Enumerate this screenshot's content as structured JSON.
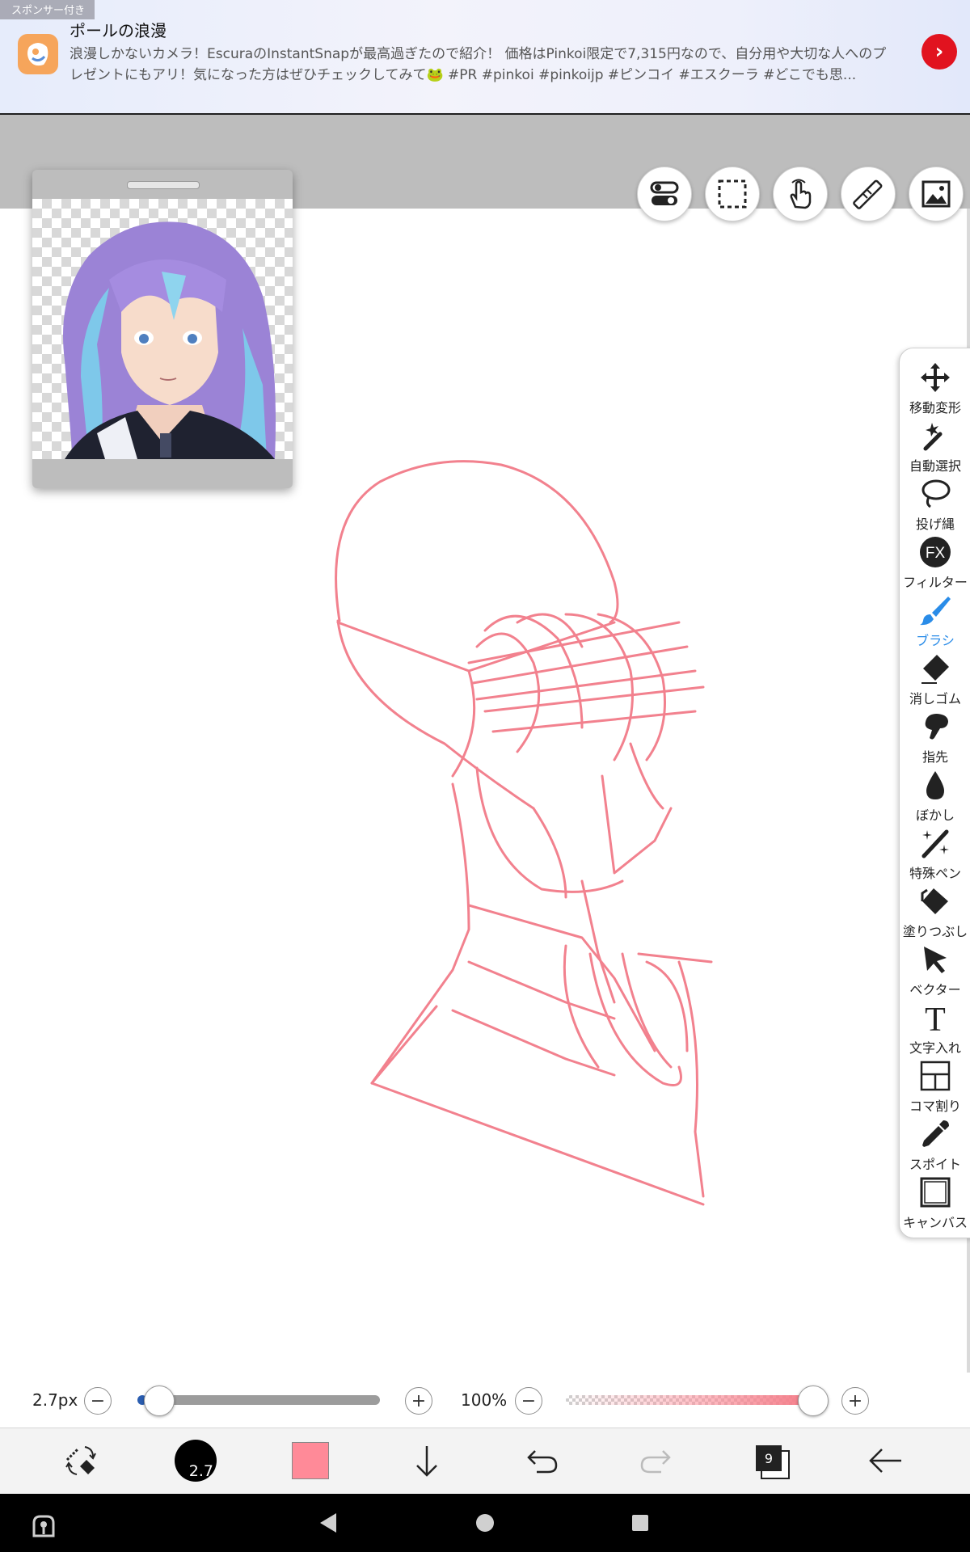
{
  "ad": {
    "sponsor_label": "スポンサー付き",
    "title": "ポールの浪漫",
    "body": "浪漫しかないカメラ！EscuraのInstantSnapが最高過ぎたので紹介！ 価格はPinkoi限定で7,315円なので、自分用や大切な人へのプレゼントにもアリ！気になった方はぜひチェックしてみて🐸 #PR #pinkoi #pinkoijp #ピンコイ #エスクーラ #どこでも思...",
    "cta_icon": "chevron-right-icon",
    "accent": "#e1131f"
  },
  "top_tools": [
    {
      "name": "toggle-icon"
    },
    {
      "name": "selection-icon"
    },
    {
      "name": "hand-icon"
    },
    {
      "name": "ruler-icon"
    },
    {
      "name": "image-icon"
    }
  ],
  "tools": [
    {
      "label": "移動変形",
      "icon": "move-icon"
    },
    {
      "label": "自動選択",
      "icon": "magic-wand-icon"
    },
    {
      "label": "投げ縄",
      "icon": "lasso-icon"
    },
    {
      "label": "フィルター",
      "icon": "fx-icon",
      "icon_text": "FX"
    },
    {
      "label": "ブラシ",
      "icon": "brush-icon",
      "active": true
    },
    {
      "label": "消しゴム",
      "icon": "eraser-icon"
    },
    {
      "label": "指先",
      "icon": "finger-icon"
    },
    {
      "label": "ぼかし",
      "icon": "blur-icon"
    },
    {
      "label": "特殊ペン",
      "icon": "special-pen-icon"
    },
    {
      "label": "塗りつぶし",
      "icon": "fill-icon"
    },
    {
      "label": "ベクター",
      "icon": "vector-icon"
    },
    {
      "label": "文字入れ",
      "icon": "text-icon",
      "icon_text": "T"
    },
    {
      "label": "コマ割り",
      "icon": "frame-divider-icon"
    },
    {
      "label": "スポイト",
      "icon": "eyedropper-icon"
    },
    {
      "label": "キャンバス",
      "icon": "canvas-icon"
    }
  ],
  "sliders": {
    "brush_size": {
      "text": "2.7px",
      "minus": "−",
      "plus": "+",
      "value_fraction": 0.02
    },
    "opacity": {
      "text": "100%",
      "minus": "−",
      "plus": "+",
      "value_fraction": 1.0
    }
  },
  "bottom_bar": {
    "brush_size_badge": "2.7",
    "current_color": "#ff8a98",
    "layer_count": "9"
  },
  "colors": {
    "accent_blue": "#2a8ce8",
    "sketch_stroke": "#f2818e"
  }
}
